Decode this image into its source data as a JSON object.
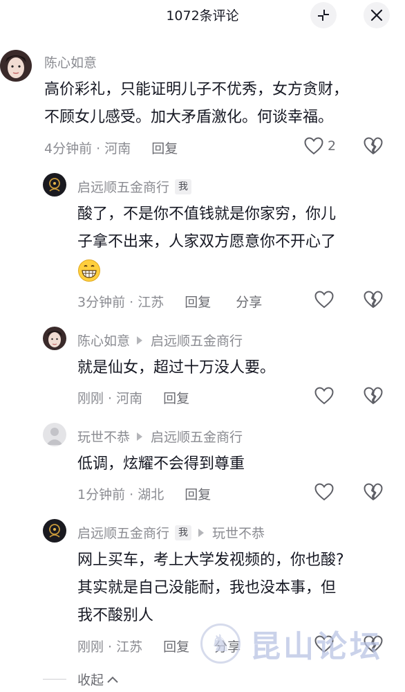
{
  "header": {
    "title": "1072条评论",
    "collapse_icon": "collapse-icon",
    "close_icon": "close-icon"
  },
  "comments": [
    {
      "author": "陈心如意",
      "is_me": false,
      "reply_to": "",
      "lines": [
        "高价彩礼，只能证明儿子不优秀，女方贪财，",
        "不顾女儿感受。加大矛盾激化。何谈幸福。"
      ],
      "time_location": "4分钟前 · 河南",
      "reply_label": "回复",
      "like_count": "2"
    },
    {
      "author": "启远顺五金商行",
      "is_me": true,
      "me_label": "我",
      "reply_to": "",
      "lines": [
        "酸了，不是你不值钱就是你家穷，你儿",
        "子拿不出来，人家双方愿意你不开心了"
      ],
      "emoji": "😁",
      "time_location": "3分钟前 · 江苏",
      "reply_label": "回复",
      "share_label": "分享"
    },
    {
      "author": "陈心如意",
      "reply_to": "启远顺五金商行",
      "lines": [
        "就是仙女，超过十万没人要。"
      ],
      "time_location": "刚刚 · 河南",
      "reply_label": "回复"
    },
    {
      "author": "玩世不恭",
      "reply_to": "启远顺五金商行",
      "lines": [
        "低调，炫耀不会得到尊重"
      ],
      "time_location": "1分钟前 · 湖北",
      "reply_label": "回复"
    },
    {
      "author": "启远顺五金商行",
      "me_label": "我",
      "reply_to": "玩世不恭",
      "lines": [
        "网上买车，考上大学发视频的，你也酸?",
        "其实就是自己没能耐，我也没本事，但",
        "我不酸别人"
      ],
      "time_location": "刚刚 · 江苏",
      "reply_label": "回复",
      "share_label": "分享"
    }
  ],
  "collapse_label": "收起",
  "watermark_text": "昆山论坛",
  "colors": {
    "text": "#161823",
    "secondary": "#8a8b91",
    "icon": "#5e5f66",
    "background": "#ffffff"
  }
}
